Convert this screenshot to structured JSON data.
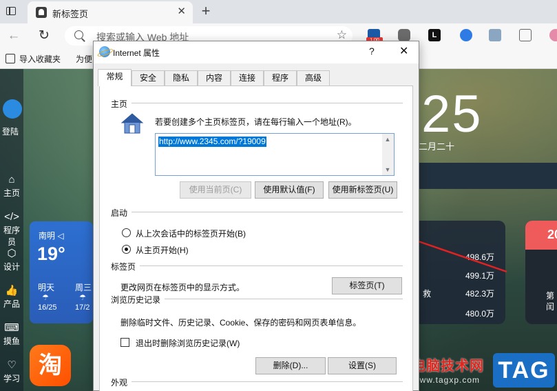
{
  "browser": {
    "tab_title": "新标签页",
    "address_placeholder": "搜索或输入 Web 地址",
    "new_tab": "+",
    "tab_close": "✕",
    "extension_badge": "1.00",
    "ext_bookmark_letter": "L",
    "favorites": {
      "import": "导入收藏夹",
      "convenient": "为便"
    }
  },
  "newtab_page": {
    "sidebar": {
      "login": "登陆",
      "items": [
        {
          "glyph": "⌂",
          "label": "主页"
        },
        {
          "glyph": "</>",
          "label": "程序员"
        },
        {
          "glyph": "⬡",
          "label": "设计"
        },
        {
          "glyph": "👍",
          "label": "产品"
        },
        {
          "glyph": "⌨",
          "label": "摸鱼"
        },
        {
          "glyph": "♡",
          "label": "学习"
        }
      ]
    },
    "weather": {
      "city": "南明",
      "city_icon": "◁",
      "temp": "19°",
      "days": [
        {
          "name": "明天",
          "temp": "16/25"
        },
        {
          "name": "周三",
          "temp": "17/2"
        }
      ]
    },
    "taobao_glyph": "淘",
    "clock": "25",
    "lunar": "二月二十",
    "hot_values": [
      "498.6万",
      "499.1万",
      "482.3万",
      "480.0万"
    ],
    "hot_label": "救",
    "red_card": {
      "title": "20",
      "line1": "第",
      "line2": "闰"
    }
  },
  "watermark": {
    "cn": "电脑技术网",
    "url": "www.tagxp.com",
    "tag": "TAG"
  },
  "dialog": {
    "title": "Internet 属性",
    "help": "?",
    "close": "✕",
    "tabs": [
      "常规",
      "安全",
      "隐私",
      "内容",
      "连接",
      "程序",
      "高级"
    ],
    "homepage": {
      "section": "主页",
      "desc": "若要创建多个主页标签页，请在每行输入一个地址(R)。",
      "url": "http://www.2345.com/?19009",
      "btn_current": "使用当前页(C)",
      "btn_default": "使用默认值(F)",
      "btn_newtab": "使用新标签页(U)"
    },
    "startup": {
      "section": "启动",
      "option_last": "从上次会话中的标签页开始(B)",
      "option_home": "从主页开始(H)"
    },
    "tabs_section": {
      "section": "标签页",
      "desc": "更改网页在标签页中的显示方式。",
      "button": "标签页(T)"
    },
    "history": {
      "section": "浏览历史记录",
      "desc": "删除临时文件、历史记录、Cookie、保存的密码和网页表单信息。",
      "checkbox": "退出时删除浏览历史记录(W)",
      "btn_delete": "删除(D)...",
      "btn_settings": "设置(S)"
    },
    "appearance": {
      "section": "外观"
    }
  },
  "colors": {
    "accent": "#0078d7",
    "arrow": "#e02222",
    "weather_card": "#2d6fd0",
    "taobao": "#ff5a00",
    "watermark_red": "#e2261d",
    "tag_blue": "#1a6fc4"
  }
}
